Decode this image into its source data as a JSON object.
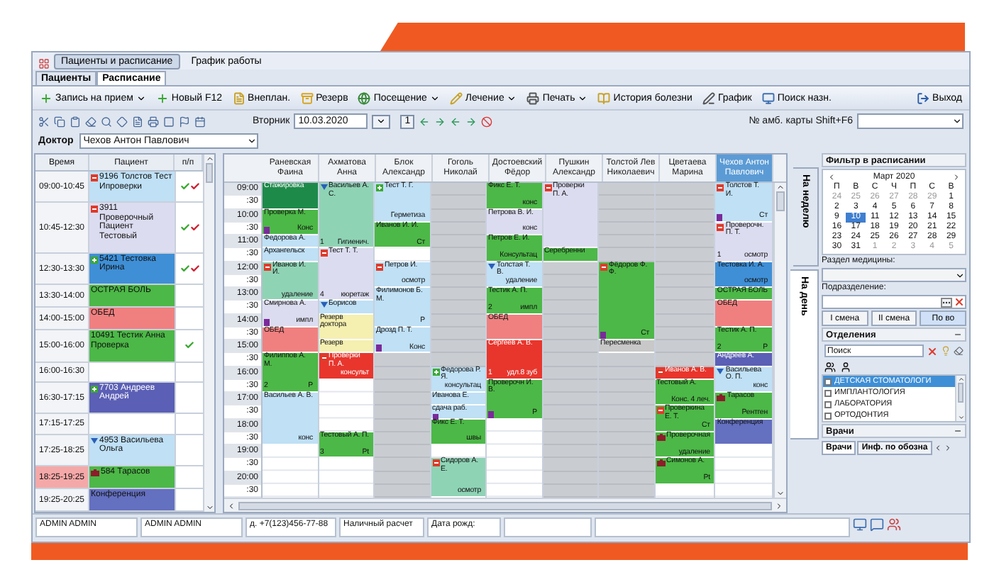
{
  "top_tabs": [
    {
      "label": "Пациенты и расписание",
      "selected": true
    },
    {
      "label": "График работы",
      "selected": false
    }
  ],
  "sub_tabs": [
    {
      "label": "Пациенты",
      "selected": false
    },
    {
      "label": "Расписание",
      "selected": true
    }
  ],
  "toolbar": [
    {
      "label": "Запись на прием",
      "dropdown": true
    },
    {
      "label": "Новый F12",
      "dropdown": false
    },
    {
      "label": "Внеплан.",
      "dropdown": false
    },
    {
      "label": "Резерв",
      "dropdown": false
    },
    {
      "label": "Посещение",
      "dropdown": true
    },
    {
      "label": "Лечение",
      "dropdown": true
    },
    {
      "label": "Печать",
      "dropdown": true
    },
    {
      "label": "История болезни",
      "dropdown": false
    },
    {
      "label": "График",
      "dropdown": false
    },
    {
      "label": "Поиск назн.",
      "dropdown": false
    },
    {
      "label": "Выход",
      "dropdown": false
    }
  ],
  "date_bar": {
    "day": "Вторник",
    "date": "10.03.2020",
    "today": "1",
    "card_label": "№ амб. карты Shift+F6"
  },
  "doctor": {
    "label": "Доктор",
    "value": "Чехов Антон Павлович"
  },
  "patients": {
    "columns": [
      "Время",
      "Пациент",
      "п/п"
    ],
    "rows": [
      {
        "time": "09:00-10:45",
        "patient": "9196 Толстов Тест Ипроверки",
        "color": "#bfe0f5",
        "marker": {
          "kind": "minus"
        },
        "marks": [
          {
            "color": "#3aa832"
          },
          {
            "color": "#cc2233"
          }
        ]
      },
      {
        "time": "10:45-12:30",
        "patient": "3911 Проверочный Пациент Тестовый",
        "color": "#dcdcf0",
        "marker": {
          "kind": "minus"
        },
        "marks": [
          {
            "color": "#3aa832"
          },
          {
            "color": "#cc2233"
          }
        ]
      },
      {
        "time": "12:30-13:30",
        "patient": "5421 Тестовка Ирина",
        "color": "#3f8fd6",
        "marker": {
          "kind": "plus"
        },
        "marks": [
          {
            "color": "#3aa832"
          },
          {
            "color": "#cc2233"
          }
        ]
      },
      {
        "time": "13:30-14:00",
        "patient": "ОСТРАЯ БОЛЬ",
        "color": "#4cb847",
        "marks": []
      },
      {
        "time": "14:00-15:00",
        "patient": "ОБЕД",
        "color": "#f08080",
        "marks": []
      },
      {
        "time": "15:00-16:00",
        "patient": "10491 Тестик Анна Проверка",
        "color": "#4cb847",
        "marks": [
          {
            "color": "#3aa832"
          }
        ]
      },
      {
        "time": "16:00-16:30",
        "color": "#ffffff",
        "marks": []
      },
      {
        "time": "16:30-17:15",
        "patient": "7703 Андреев Андрей",
        "color": "#5b5fb5",
        "marker": {
          "kind": "plus"
        },
        "marks": []
      },
      {
        "time": "17:15-17:25",
        "color": "#ffffff",
        "marks": []
      },
      {
        "time": "17:25-18:25",
        "patient": "4953 Васильева Ольга",
        "color": "#bfe0f5",
        "marker": {
          "kind": "flag"
        },
        "marks": []
      },
      {
        "time": "18:25-19:25",
        "patient": "584 Тарасов",
        "color": "#4cb847",
        "marker": {
          "kind": "case"
        },
        "time_highlight": true,
        "marks": []
      },
      {
        "time": "19:25-20:25",
        "patient": "Конференция",
        "color": "#6470c0",
        "marks": []
      }
    ]
  },
  "schedule": {
    "times": [
      "09:00",
      ":30",
      "10:00",
      ":30",
      "11:00",
      ":30",
      "12:00",
      ":30",
      "13:00",
      ":30",
      "14:00",
      ":30",
      "15:00",
      ":30",
      "16:00",
      ":30",
      "17:00",
      ":30",
      "18:00",
      ":30",
      "19:00",
      ":30",
      "20:00",
      ":30"
    ],
    "doctors": [
      {
        "name": "Раневская Фаина",
        "selected": false,
        "slots": [
          {
            "kind": "appointment",
            "text": "Стажировка",
            "color": "#1e8a4a"
          },
          {
            "kind": "cont"
          },
          {
            "kind": "appointment",
            "text": "Проверка М.",
            "note": "Конс",
            "tag": true,
            "color": "#4cb847"
          },
          {
            "kind": "cont"
          },
          {
            "kind": "appointment",
            "text": "Федорова А.",
            "color": "#bfe0f5"
          },
          {
            "kind": "appointment",
            "text": "Архангельск",
            "color": "#bfe0f5"
          },
          {
            "kind": "appointment",
            "text": "Иванов И. И.",
            "note": "удаление",
            "marker": {
              "kind": "minus"
            },
            "color": "#8fd3b5"
          },
          {
            "kind": "cont"
          },
          {
            "kind": "cont"
          },
          {
            "kind": "appointment",
            "text": "Смирнова А.",
            "note": "импл",
            "tag": true,
            "color": "#dcdcf0"
          },
          {
            "kind": "cont"
          },
          {
            "kind": "appointment",
            "text": "ОБЕД",
            "color": "#f08080"
          },
          {
            "kind": "cont"
          },
          {
            "kind": "appointment",
            "text": "Филиппов А. М.",
            "count": "2",
            "note": "Р",
            "color": "#4cb847"
          },
          {
            "kind": "cont"
          },
          {
            "kind": "cont"
          },
          {
            "kind": "appointment",
            "text": "Васильев А. В.",
            "note": "конс",
            "color": "#bfe0f5"
          },
          {
            "kind": "cont"
          },
          {
            "kind": "cont"
          },
          {
            "kind": "cont"
          },
          {
            "kind": "free"
          },
          {
            "kind": "free"
          },
          {
            "kind": "free"
          },
          {
            "kind": "free"
          }
        ]
      },
      {
        "name": "Ахматова Анна",
        "selected": false,
        "slots": [
          {
            "kind": "appointment",
            "text": "Васильев А. С.",
            "count": "1",
            "note": "Гигиенич.",
            "marker": {
              "kind": "flag"
            },
            "color": "#8fd3b5"
          },
          {
            "kind": "cont"
          },
          {
            "kind": "cont"
          },
          {
            "kind": "cont"
          },
          {
            "kind": "cont"
          },
          {
            "kind": "appointment",
            "text": "Тест Т. Т.",
            "count": "4",
            "note": "кюретаж",
            "marker": {
              "kind": "minus"
            },
            "color": "#dcdcf0"
          },
          {
            "kind": "cont"
          },
          {
            "kind": "cont"
          },
          {
            "kind": "cont"
          },
          {
            "kind": "appointment",
            "text": "Борисов",
            "marker": {
              "kind": "flag"
            },
            "color": "#bfe0f5"
          },
          {
            "kind": "appointment",
            "text": "Резерв доктора",
            "color": "#f5efb0"
          },
          {
            "kind": "cont"
          },
          {
            "kind": "appointment",
            "text": "Резерв",
            "color": "#f5efb0"
          },
          {
            "kind": "appointment",
            "text": "Проверки П. А.",
            "note": "консульт",
            "marker": {
              "kind": "minus"
            },
            "color": "#e8362d"
          },
          {
            "kind": "cont"
          },
          {
            "kind": "free"
          },
          {
            "kind": "free"
          },
          {
            "kind": "free"
          },
          {
            "kind": "free"
          },
          {
            "kind": "appointment",
            "text": "Тестовый А. П.",
            "count": "3",
            "note": "Pt",
            "color": "#4cb847"
          },
          {
            "kind": "cont"
          },
          {
            "kind": "free"
          },
          {
            "kind": "free"
          },
          {
            "kind": "free"
          }
        ]
      },
      {
        "name": "Блок Александр",
        "selected": false,
        "slots": [
          {
            "kind": "appointment",
            "text": "Тест Т. Г.",
            "note": "Герметиза",
            "marker": {
              "kind": "plus"
            },
            "color": "#bfe0f5"
          },
          {
            "kind": "cont"
          },
          {
            "kind": "cont"
          },
          {
            "kind": "appointment",
            "text": "Иванов И. И.",
            "note": "Ст",
            "color": "#4cb847"
          },
          {
            "kind": "cont"
          },
          {
            "kind": "free"
          },
          {
            "kind": "appointment",
            "text": "Петров И.",
            "note": "осмотр",
            "marker": {
              "kind": "minus"
            },
            "color": "#bfe0f5"
          },
          {
            "kind": "cont"
          },
          {
            "kind": "appointment",
            "text": "Филимонов Б. М.",
            "note": "Р",
            "color": "#bfe0f5"
          },
          {
            "kind": "cont"
          },
          {
            "kind": "cont"
          },
          {
            "kind": "appointment",
            "text": "Дрозд П. Т.",
            "note": "Конс",
            "tag": true,
            "color": "#bfe0f5"
          },
          {
            "kind": "cont"
          },
          {
            "kind": "off"
          },
          {
            "kind": "off"
          },
          {
            "kind": "off"
          },
          {
            "kind": "off"
          },
          {
            "kind": "off"
          },
          {
            "kind": "off"
          },
          {
            "kind": "off"
          },
          {
            "kind": "off"
          },
          {
            "kind": "off"
          },
          {
            "kind": "off"
          },
          {
            "kind": "off"
          }
        ]
      },
      {
        "name": "Гоголь Николай",
        "selected": false,
        "slots": [
          {
            "kind": "off"
          },
          {
            "kind": "off"
          },
          {
            "kind": "off"
          },
          {
            "kind": "off"
          },
          {
            "kind": "off"
          },
          {
            "kind": "off"
          },
          {
            "kind": "off"
          },
          {
            "kind": "off"
          },
          {
            "kind": "off"
          },
          {
            "kind": "off"
          },
          {
            "kind": "off"
          },
          {
            "kind": "off"
          },
          {
            "kind": "off"
          },
          {
            "kind": "off"
          },
          {
            "kind": "appointment",
            "text": "Федорова Р. Я.",
            "note": "консультац",
            "marker": {
              "kind": "plus"
            },
            "color": "#bfe0f5"
          },
          {
            "kind": "cont"
          },
          {
            "kind": "appointment",
            "text": "Иванова Е.",
            "color": "#bfe0f5"
          },
          {
            "kind": "appointment",
            "text": "сдача раб.",
            "tag": true,
            "color": "#bfe0f5"
          },
          {
            "kind": "appointment",
            "text": "Фикс Е. Т.",
            "note": "швы",
            "color": "#4cb847"
          },
          {
            "kind": "cont"
          },
          {
            "kind": "free"
          },
          {
            "kind": "appointment",
            "text": "Сидоров А. Е.",
            "note": "осмотр",
            "marker": {
              "kind": "minus"
            },
            "color": "#8fd3b5"
          },
          {
            "kind": "cont"
          },
          {
            "kind": "cont"
          }
        ]
      },
      {
        "name": "Достоевский Фёдор",
        "selected": false,
        "slots": [
          {
            "kind": "appointment",
            "text": "Фикс Е. Т.",
            "note": "конс",
            "color": "#4cb847"
          },
          {
            "kind": "cont"
          },
          {
            "kind": "appointment",
            "text": "Петрова В. И.",
            "note": "конс",
            "color": "#dcdcf0"
          },
          {
            "kind": "cont"
          },
          {
            "kind": "appointment",
            "text": "Петров Е. И.",
            "note": "Консультац",
            "color": "#4cb847"
          },
          {
            "kind": "cont"
          },
          {
            "kind": "appointment",
            "text": "Толстая Т. В.",
            "note": "удаление",
            "marker": {
              "kind": "flag"
            },
            "color": "#bfe0f5"
          },
          {
            "kind": "cont"
          },
          {
            "kind": "appointment",
            "text": "Тестик А. П.",
            "count": "2",
            "note": "импл",
            "color": "#4cb847"
          },
          {
            "kind": "cont"
          },
          {
            "kind": "appointment",
            "text": "ОБЕД",
            "color": "#f08080"
          },
          {
            "kind": "cont"
          },
          {
            "kind": "appointment",
            "text": "Сергеев А. В.",
            "count": "1",
            "note": "удл.8 зуб",
            "color": "#e8362d"
          },
          {
            "kind": "cont"
          },
          {
            "kind": "cont"
          },
          {
            "kind": "appointment",
            "text": "Проверочн И. В.",
            "note": "Р",
            "tag": true,
            "color": "#4cb847"
          },
          {
            "kind": "cont"
          },
          {
            "kind": "cont"
          },
          {
            "kind": "free"
          },
          {
            "kind": "free"
          },
          {
            "kind": "free"
          },
          {
            "kind": "free"
          },
          {
            "kind": "free"
          },
          {
            "kind": "free"
          }
        ]
      },
      {
        "name": "Пушкин Александр",
        "selected": false,
        "slots": [
          {
            "kind": "appointment",
            "text": "Проверки П. А.",
            "marker": {
              "kind": "minus"
            },
            "color": "#dcdcf0"
          },
          {
            "kind": "cont"
          },
          {
            "kind": "cont"
          },
          {
            "kind": "cont"
          },
          {
            "kind": "cont"
          },
          {
            "kind": "appointment",
            "text": "Серебренни",
            "color": "#4cb847"
          },
          {
            "kind": "off"
          },
          {
            "kind": "off"
          },
          {
            "kind": "off"
          },
          {
            "kind": "off"
          },
          {
            "kind": "off"
          },
          {
            "kind": "off"
          },
          {
            "kind": "off"
          },
          {
            "kind": "off"
          },
          {
            "kind": "off"
          },
          {
            "kind": "off"
          },
          {
            "kind": "off"
          },
          {
            "kind": "off"
          },
          {
            "kind": "off"
          },
          {
            "kind": "off"
          },
          {
            "kind": "off"
          },
          {
            "kind": "off"
          },
          {
            "kind": "off"
          },
          {
            "kind": "off"
          }
        ]
      },
      {
        "name": "Толстой Лев Николаевич",
        "selected": false,
        "slots": [
          {
            "kind": "off"
          },
          {
            "kind": "off"
          },
          {
            "kind": "off"
          },
          {
            "kind": "off"
          },
          {
            "kind": "off"
          },
          {
            "kind": "off"
          },
          {
            "kind": "appointment",
            "text": "Фёдоров Ф. Ф.",
            "note": "Ст",
            "marker": {
              "kind": "minus"
            },
            "tag": true,
            "color": "#4cb847"
          },
          {
            "kind": "cont"
          },
          {
            "kind": "cont"
          },
          {
            "kind": "cont"
          },
          {
            "kind": "cont"
          },
          {
            "kind": "cont"
          },
          {
            "kind": "appointment",
            "text": "Пересменка",
            "color": "#c8c8c8"
          },
          {
            "kind": "off"
          },
          {
            "kind": "off"
          },
          {
            "kind": "off"
          },
          {
            "kind": "off"
          },
          {
            "kind": "off"
          },
          {
            "kind": "off"
          },
          {
            "kind": "off"
          },
          {
            "kind": "off"
          },
          {
            "kind": "off"
          },
          {
            "kind": "off"
          },
          {
            "kind": "off"
          }
        ]
      },
      {
        "name": "Цветаева Марина",
        "selected": false,
        "slots": [
          {
            "kind": "off"
          },
          {
            "kind": "off"
          },
          {
            "kind": "off"
          },
          {
            "kind": "off"
          },
          {
            "kind": "off"
          },
          {
            "kind": "off"
          },
          {
            "kind": "off"
          },
          {
            "kind": "off"
          },
          {
            "kind": "off"
          },
          {
            "kind": "off"
          },
          {
            "kind": "off"
          },
          {
            "kind": "off"
          },
          {
            "kind": "off"
          },
          {
            "kind": "off"
          },
          {
            "kind": "appointment",
            "text": "Иванов А. В.",
            "marker": {
              "kind": "minus"
            },
            "color": "#e8362d"
          },
          {
            "kind": "appointment",
            "text": "Тестовый А.",
            "note": "Конс. 4 леч.",
            "color": "#4cb847"
          },
          {
            "kind": "cont"
          },
          {
            "kind": "appointment",
            "text": "Проверкина Е. Т.",
            "note": "Ст",
            "marker": {
              "kind": "minus"
            },
            "color": "#4cb847"
          },
          {
            "kind": "cont"
          },
          {
            "kind": "appointment",
            "text": "Проверочная",
            "note": "удаление",
            "marker": {
              "kind": "case"
            },
            "color": "#4cb847"
          },
          {
            "kind": "cont"
          },
          {
            "kind": "appointment",
            "text": "Симонов А.",
            "note": "Pt",
            "marker": {
              "kind": "case"
            },
            "color": "#4cb847"
          },
          {
            "kind": "cont"
          },
          {
            "kind": "free"
          }
        ]
      },
      {
        "name": "Чехов Антон Павлович",
        "selected": true,
        "slots": [
          {
            "kind": "appointment",
            "text": "Толстов Т. И.",
            "note": "Ст",
            "marker": {
              "kind": "minus"
            },
            "tag": true,
            "color": "#bfe0f5"
          },
          {
            "kind": "cont"
          },
          {
            "kind": "cont"
          },
          {
            "kind": "appointment",
            "text": "Проверочн. П. Т.",
            "count": "1",
            "note": "осмотр",
            "marker": {
              "kind": "minus"
            },
            "color": "#dcdcf0"
          },
          {
            "kind": "cont"
          },
          {
            "kind": "cont"
          },
          {
            "kind": "appointment",
            "text": "Тестовка И. А.",
            "note": "осмотр",
            "color": "#3f8fd6"
          },
          {
            "kind": "cont"
          },
          {
            "kind": "appointment",
            "text": "ОСТРАЯ БОЛЬ",
            "color": "#4cb847"
          },
          {
            "kind": "appointment",
            "text": "ОБЕД",
            "color": "#f08080"
          },
          {
            "kind": "cont"
          },
          {
            "kind": "appointment",
            "text": "Тестик А. П.",
            "count": "2",
            "note": "Р",
            "color": "#4cb847"
          },
          {
            "kind": "cont"
          },
          {
            "kind": "appointment",
            "text": "Андреев А.",
            "color": "#5b5fb5"
          },
          {
            "kind": "appointment",
            "text": "Васильева О. П.",
            "note": "конс",
            "marker": {
              "kind": "flag"
            },
            "color": "#bfe0f5"
          },
          {
            "kind": "cont"
          },
          {
            "kind": "appointment",
            "text": "Тарасов",
            "note": "Рентген",
            "marker": {
              "kind": "case"
            },
            "color": "#4cb847"
          },
          {
            "kind": "cont"
          },
          {
            "kind": "appointment",
            "text": "Конференция",
            "color": "#6470c0"
          },
          {
            "kind": "cont"
          },
          {
            "kind": "free"
          },
          {
            "kind": "free"
          },
          {
            "kind": "free"
          },
          {
            "kind": "free"
          }
        ]
      }
    ]
  },
  "view_tabs": [
    {
      "label": "На неделю",
      "selected": false
    },
    {
      "label": "На день",
      "selected": true
    }
  ],
  "filter": {
    "title": "Фильтр в расписании",
    "calendar": {
      "month": "Март 2020",
      "weekdays": [
        "П",
        "В",
        "С",
        "Ч",
        "П",
        "С",
        "В"
      ],
      "days": [
        {
          "label": "24",
          "other_month": true,
          "selected": false
        },
        {
          "label": "25",
          "other_month": true,
          "selected": false
        },
        {
          "label": "26",
          "other_month": true,
          "selected": false
        },
        {
          "label": "27",
          "other_month": true,
          "selected": false
        },
        {
          "label": "28",
          "other_month": true,
          "selected": false
        },
        {
          "label": "29",
          "other_month": true,
          "selected": false
        },
        {
          "label": "1",
          "other_month": false,
          "selected": false
        },
        {
          "label": "2",
          "other_month": false,
          "selected": false
        },
        {
          "label": "3",
          "other_month": false,
          "selected": false
        },
        {
          "label": "4",
          "other_month": false,
          "selected": false
        },
        {
          "label": "5",
          "other_month": false,
          "selected": false
        },
        {
          "label": "6",
          "other_month": false,
          "selected": false
        },
        {
          "label": "7",
          "other_month": false,
          "selected": false
        },
        {
          "label": "8",
          "other_month": false,
          "selected": false
        },
        {
          "label": "9",
          "other_month": false,
          "selected": false
        },
        {
          "label": "10",
          "other_month": false,
          "selected": true
        },
        {
          "label": "11",
          "other_month": false,
          "selected": false
        },
        {
          "label": "12",
          "other_month": false,
          "selected": false
        },
        {
          "label": "13",
          "other_month": false,
          "selected": false
        },
        {
          "label": "14",
          "other_month": false,
          "selected": false
        },
        {
          "label": "15",
          "other_month": false,
          "selected": false
        },
        {
          "label": "16",
          "other_month": false,
          "selected": false
        },
        {
          "label": "17",
          "other_month": false,
          "selected": false
        },
        {
          "label": "18",
          "other_month": false,
          "selected": false
        },
        {
          "label": "19",
          "other_month": false,
          "selected": false
        },
        {
          "label": "20",
          "other_month": false,
          "selected": false
        },
        {
          "label": "21",
          "other_month": false,
          "selected": false
        },
        {
          "label": "22",
          "other_month": false,
          "selected": false
        },
        {
          "label": "23",
          "other_month": false,
          "selected": false
        },
        {
          "label": "24",
          "other_month": false,
          "selected": false
        },
        {
          "label": "25",
          "other_month": false,
          "selected": false
        },
        {
          "label": "26",
          "other_month": false,
          "selected": false
        },
        {
          "label": "27",
          "other_month": false,
          "selected": false
        },
        {
          "label": "28",
          "other_month": false,
          "selected": false
        },
        {
          "label": "29",
          "other_month": false,
          "selected": false
        },
        {
          "label": "30",
          "other_month": false,
          "selected": false
        },
        {
          "label": "31",
          "other_month": false,
          "selected": false
        },
        {
          "label": "1",
          "other_month": true,
          "selected": false
        },
        {
          "label": "2",
          "other_month": true,
          "selected": false
        },
        {
          "label": "3",
          "other_month": true,
          "selected": false
        },
        {
          "label": "4",
          "other_month": true,
          "selected": false
        },
        {
          "label": "5",
          "other_month": true,
          "selected": false
        }
      ]
    },
    "section_label": "Раздел медицины:",
    "unit_label": "Подразделение:",
    "shifts": [
      {
        "label": "I смена",
        "selected": false
      },
      {
        "label": "II смена",
        "selected": false
      },
      {
        "label": "По во",
        "selected": true
      }
    ],
    "departments": {
      "title": "Отделения",
      "search_label": "Поиск",
      "items": [
        {
          "label": "ДЕТСКАЯ СТОМАТОЛОГИ",
          "selected": true
        },
        {
          "label": "ИМПЛАНТОЛОГИЯ",
          "selected": false
        },
        {
          "label": "ЛАБОРАТОРИЯ",
          "selected": false
        },
        {
          "label": "ОРТОДОНТИЯ",
          "selected": false
        }
      ]
    },
    "doctors_panel": {
      "title": "Врачи",
      "tabs": [
        {
          "label": "Врачи",
          "selected": true
        },
        {
          "label": "Инф. по обозна",
          "selected": false
        }
      ]
    }
  },
  "status_bar": [
    "ADMIN ADMIN",
    "ADMIN ADMIN",
    "д. +7(123)456-77-88",
    "Наличный расчет",
    "Дата рожд:"
  ]
}
